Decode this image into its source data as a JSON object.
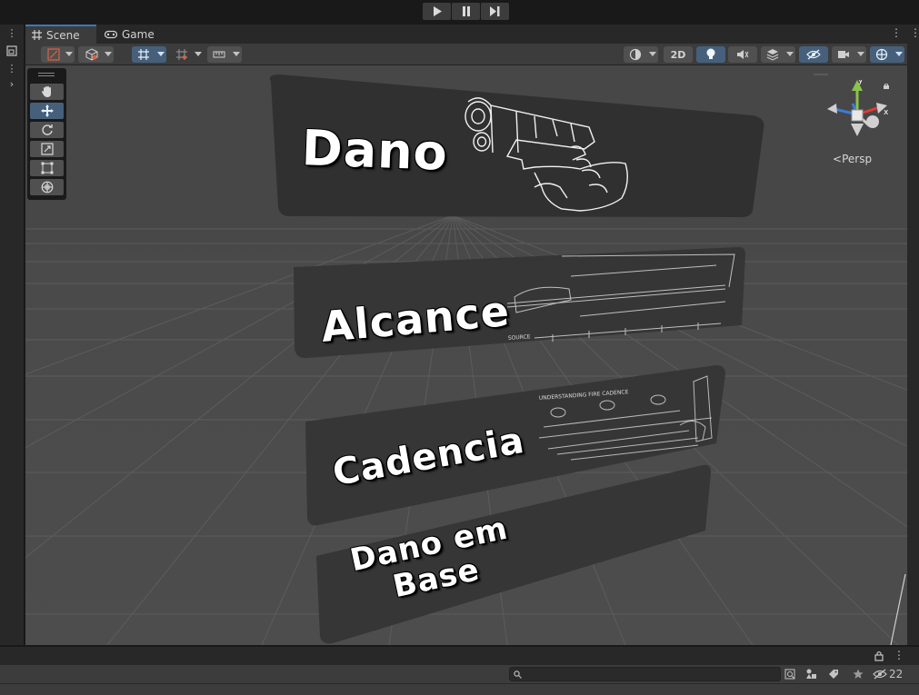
{
  "window": {
    "tabs": [
      {
        "label": "Scene",
        "icon": "grid-icon",
        "active": true
      },
      {
        "label": "Game",
        "icon": "gamepad-icon",
        "active": false
      }
    ]
  },
  "playbar": {
    "buttons": [
      "play",
      "pause",
      "step"
    ]
  },
  "toolbar": {
    "view_2d_label": "2D",
    "left_tools": [
      "transform-handle-dropdown",
      "pivot-dropdown",
      "grid-snap-dropdown",
      "increment-snap-dropdown",
      "ruler-dropdown"
    ],
    "right_tools": [
      "shading-mode",
      "2d-toggle",
      "lighting-toggle",
      "audio-toggle",
      "effects-dropdown",
      "visibility-toggle",
      "camera-dropdown",
      "gizmos-dropdown"
    ]
  },
  "tool_palette": {
    "tools": [
      "hand-tool",
      "move-tool",
      "rotate-tool",
      "scale-tool",
      "rect-tool",
      "transform-tool"
    ],
    "active": "move-tool"
  },
  "gizmo": {
    "axis_y": "y",
    "axis_x": "x",
    "projection_label": "Persp"
  },
  "scene": {
    "cards": [
      {
        "title": "Dano",
        "image": "handgun-outline-drawing"
      },
      {
        "title": "Alcance",
        "image": "rifle-range-diagram"
      },
      {
        "title": "Cadencia",
        "image": "fire-rate-diagram"
      },
      {
        "title_line1": "Dano em",
        "title_line2": "Base",
        "image": ""
      }
    ],
    "diagram_text": {
      "alcance_source": "SOURCE",
      "cadencia_header": "UNDERSTANDING FIRE CADENCE"
    }
  },
  "bottom": {
    "search_placeholder": "",
    "hidden_count": "22"
  },
  "colors": {
    "accent": "#3a79bb",
    "viewport_bg": "#474747",
    "panel_bg": "#3c3c3c",
    "dark_bg": "#282828",
    "gizmo_y": "#8bc34a",
    "gizmo_x": "#e53935",
    "gizmo_z": "#3d7bd9"
  }
}
